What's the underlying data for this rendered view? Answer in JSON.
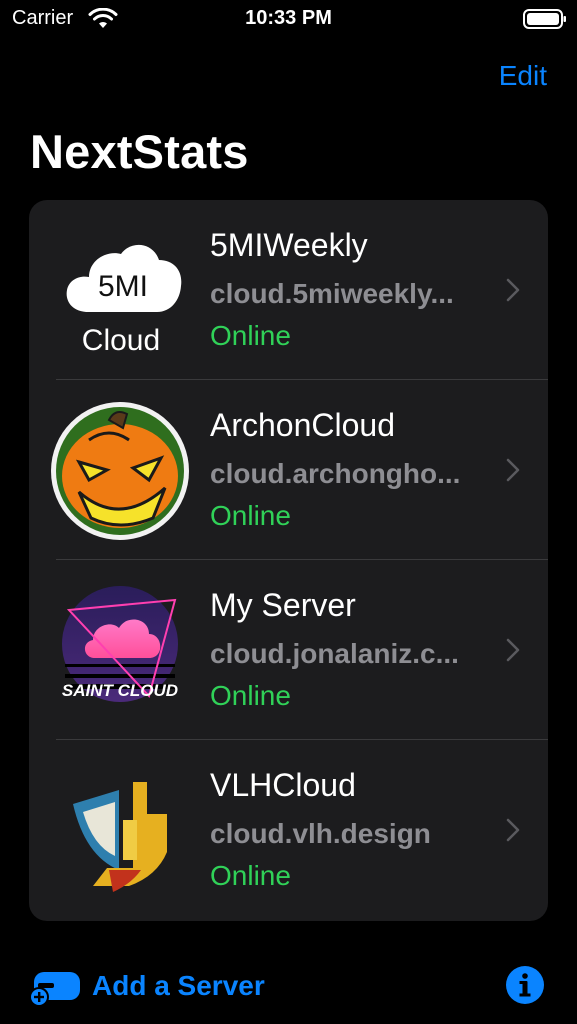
{
  "status_bar": {
    "carrier": "Carrier",
    "time": "10:33 PM"
  },
  "nav": {
    "edit_label": "Edit",
    "title": "NextStats"
  },
  "servers": [
    {
      "name": "5MIWeekly",
      "url": "cloud.5miweekly...",
      "status": "Online",
      "logo": "5mi-cloud-logo"
    },
    {
      "name": "ArchonCloud",
      "url": "cloud.archongho...",
      "status": "Online",
      "logo": "pumpkin-logo"
    },
    {
      "name": "My Server",
      "url": "cloud.jonalaniz.c...",
      "status": "Online",
      "logo": "saint-cloud-logo"
    },
    {
      "name": "VLHCloud",
      "url": "cloud.vlh.design",
      "status": "Online",
      "logo": "vlh-logo"
    }
  ],
  "logo_text": {
    "fivemi": "5MI",
    "cloud": "Cloud",
    "saint_cloud": "SAINT CLOUD"
  },
  "bottom": {
    "add_label": "Add a Server"
  },
  "colors": {
    "accent": "#0a84ff",
    "online": "#30d158",
    "cell_bg": "#1c1c1e",
    "secondary": "#8e8e93"
  }
}
